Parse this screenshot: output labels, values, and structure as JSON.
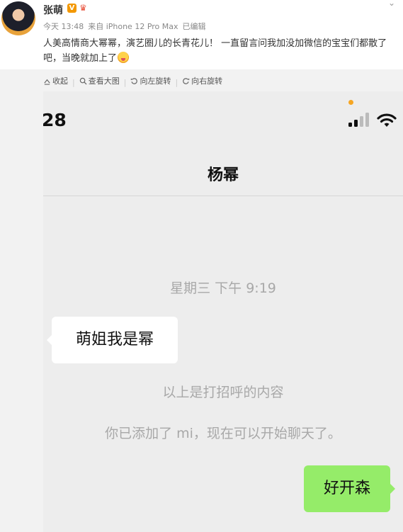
{
  "post": {
    "username": "张萌",
    "verified_badge": "V",
    "meta": {
      "time": "今天 13:48",
      "source": "来自 iPhone 12 Pro Max",
      "edited": "已编辑"
    },
    "text": "人美高情商大幂幂，演艺圈儿的长青花儿！ 一直留言问我加没加微信的宝宝们都散了吧，当晚就加上了"
  },
  "toolbar": {
    "collapse": "收起",
    "view_large": "查看大图",
    "rotate_left": "向左旋转",
    "rotate_right": "向右旋转",
    "separator": "|"
  },
  "phone": {
    "status_time": ":28",
    "chat_title": "杨幂",
    "timestamp": "星期三 下午 9:19",
    "incoming_message": "萌姐我是幂",
    "system_greeting": "以上是打招呼的内容",
    "system_added": "你已添加了 mi，现在可以开始聊天了。",
    "outgoing_message": "好开森"
  },
  "colors": {
    "outgoing_bubble": "#95ec69",
    "incoming_bubble": "#ffffff",
    "chat_background": "#ededed",
    "status_dot": "#f6a623"
  }
}
